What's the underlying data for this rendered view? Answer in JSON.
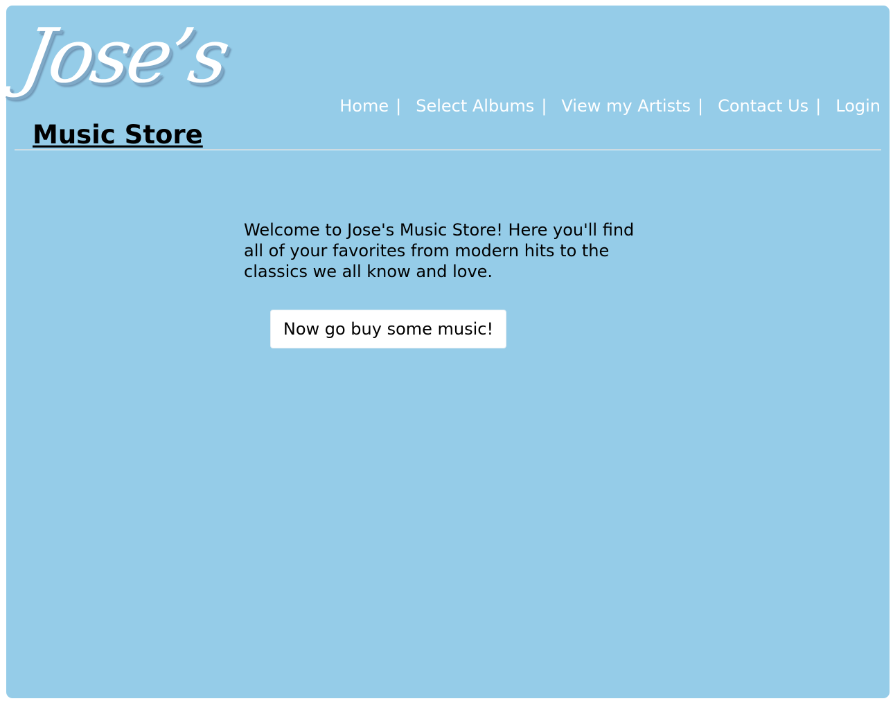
{
  "header": {
    "logo_script": "Jose’s",
    "logo_subtitle": "Music Store"
  },
  "nav": {
    "items": [
      {
        "label": "Home"
      },
      {
        "label": "Select Albums"
      },
      {
        "label": "View my Artists"
      },
      {
        "label": "Contact Us"
      },
      {
        "label": "Login"
      }
    ],
    "separator": "|"
  },
  "main": {
    "welcome_text": "Welcome to Jose's Music Store! Here you'll find all of your favorites from modern hits to the classics we all know and love.",
    "cta_label": "Now go buy some music!"
  },
  "colors": {
    "page_background": "#95cce8",
    "nav_text": "#ffffff",
    "button_background": "#ffffff"
  }
}
